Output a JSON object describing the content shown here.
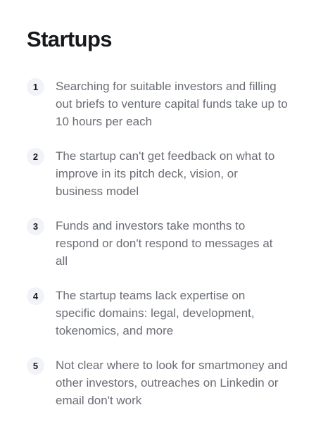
{
  "section": {
    "title": "Startups"
  },
  "problems": [
    {
      "number": "1",
      "text": "Searching for suitable investors and filling out briefs to venture capital funds take up to 10 hours per each"
    },
    {
      "number": "2",
      "text": "The startup can't get feedback on what to improve in its pitch deck, vision, or business model"
    },
    {
      "number": "3",
      "text": "Funds and investors take months to respond or don't respond to messages at all"
    },
    {
      "number": "4",
      "text": "The startup teams lack expertise on specific domains: legal, development, tokenomics, and more"
    },
    {
      "number": "5",
      "text": "Not clear where to look for smartmoney and other investors, outreaches on Linkedin or email don't work"
    }
  ]
}
